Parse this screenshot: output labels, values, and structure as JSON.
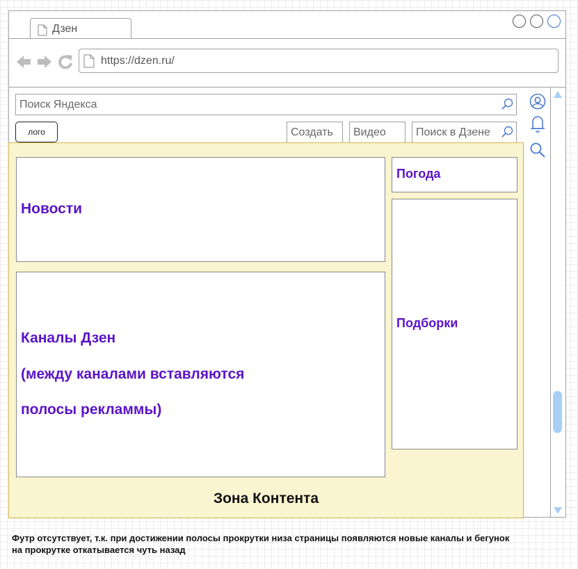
{
  "browser": {
    "tab_title": "Дзен",
    "url": "https://dzen.ru/"
  },
  "header": {
    "yandex_search_placeholder": "Поиск Яндекса",
    "logo_label": "лого",
    "create_label": "Создать",
    "video_label": "Видео",
    "dzen_search_placeholder": "Поиск в Дзене"
  },
  "side_icons": [
    "profile-icon",
    "bell-icon",
    "search-icon"
  ],
  "content": {
    "news_label": "Новости",
    "channels_lines": [
      "Каналы Дзен",
      "(между каналами вставляются",
      "полосы рекламмы)"
    ],
    "weather_label": "Погода",
    "collections_label": "Подборки",
    "zone_label": "Зона Контента"
  },
  "footnote": "Футр отсутствует, т.к. при достижении полосы прокрутки низа страницы появляются новые каналы и бегунок на прокрутке откатывается чуть назад",
  "colors": {
    "accent_purple": "#5a14c8",
    "content_zone_bg": "#fbf4d0",
    "content_zone_border": "#d0b448",
    "scroll_blue": "#a8d0f5"
  }
}
